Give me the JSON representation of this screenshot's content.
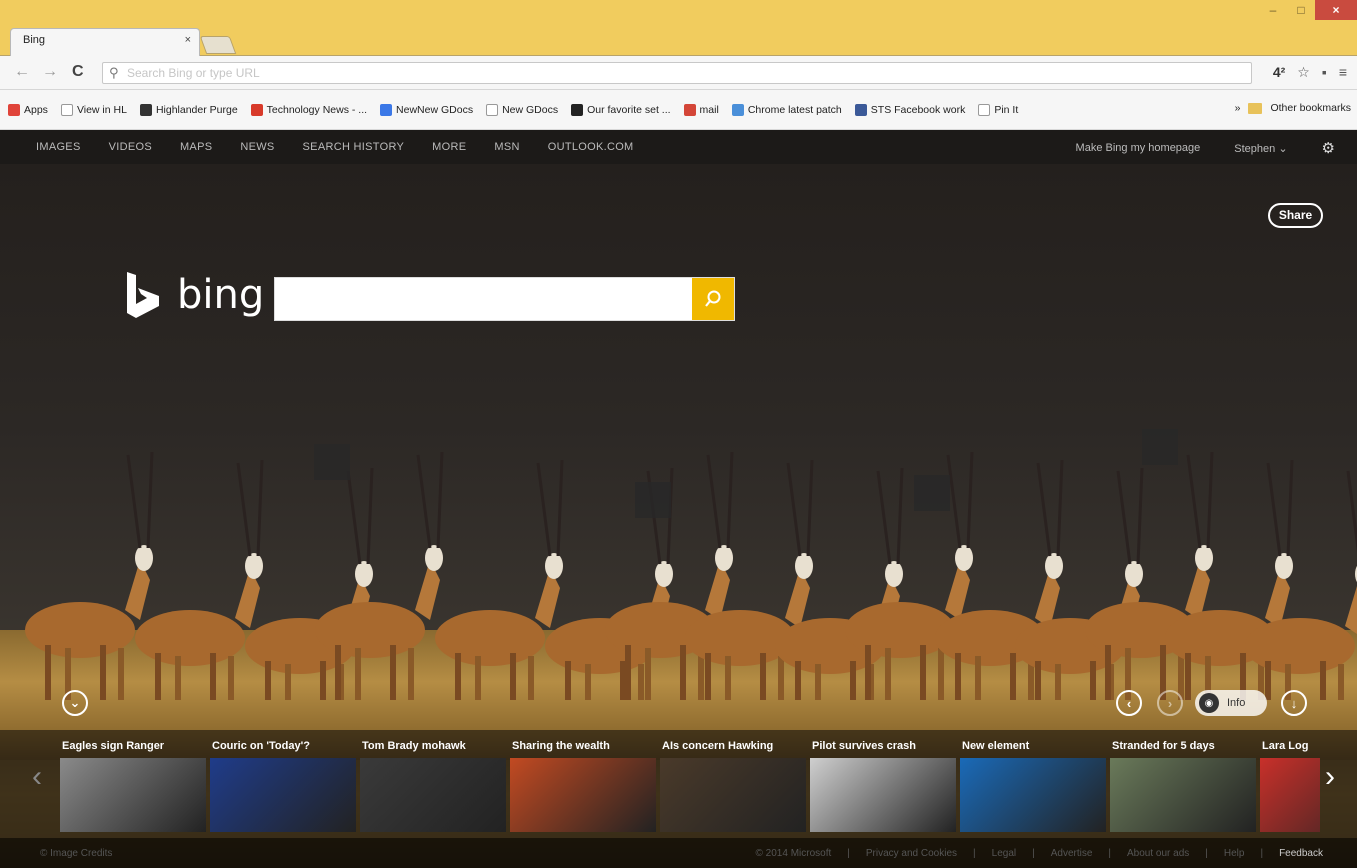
{
  "browser": {
    "tab_title": "Bing",
    "tab_close": "×",
    "omnibox_placeholder": "Search Bing or type URL",
    "window_controls": {
      "minimize": "–",
      "maximize": "□",
      "close": "×"
    }
  },
  "bookmarks": {
    "items": [
      {
        "label": "Apps",
        "icon": "apps-grid-icon",
        "color": "#e0443a"
      },
      {
        "label": "View in HL",
        "icon": "page-icon",
        "color": "#ffffff"
      },
      {
        "label": "Highlander Purge",
        "icon": "github-icon",
        "color": "#333333"
      },
      {
        "label": "Technology News - ...",
        "icon": "circle-logo-icon",
        "color": "#d83a2a"
      },
      {
        "label": "NewNew GDocs",
        "icon": "docs-icon",
        "color": "#3b78e7"
      },
      {
        "label": "New GDocs",
        "icon": "page-icon",
        "color": "#ffffff"
      },
      {
        "label": "Our favorite set ...",
        "icon": "star-plus-icon",
        "color": "#222222"
      },
      {
        "label": "mail",
        "icon": "gmail-icon",
        "color": "#d44638"
      },
      {
        "label": "Chrome latest patch",
        "icon": "chrome-icon",
        "color": "#4a8fd9"
      },
      {
        "label": "STS Facebook work",
        "icon": "facebook-icon",
        "color": "#3b5998"
      },
      {
        "label": "Pin It",
        "icon": "page-icon",
        "color": "#ffffff"
      }
    ],
    "overflow": "»",
    "other": "Other bookmarks"
  },
  "bing": {
    "nav": [
      "IMAGES",
      "VIDEOS",
      "MAPS",
      "NEWS",
      "SEARCH HISTORY",
      "MORE",
      "MSN",
      "OUTLOOK.COM"
    ],
    "make_homepage": "Make Bing my homepage",
    "user": "Stephen",
    "share": "Share",
    "logo_text": "bing",
    "info": "Info",
    "accent": "#f0b800"
  },
  "news": [
    {
      "title": "Eagles sign Ranger",
      "color": "#8a8a8a"
    },
    {
      "title": "Couric on 'Today'?",
      "color": "#1f3c8a"
    },
    {
      "title": "Tom Brady mohawk",
      "color": "#3a3a3a"
    },
    {
      "title": "Sharing the wealth",
      "color": "#c24a22"
    },
    {
      "title": "AIs concern Hawking",
      "color": "#4a3a2a"
    },
    {
      "title": "Pilot survives crash",
      "color": "#cfcfcf"
    },
    {
      "title": "New element",
      "color": "#1a6ab8"
    },
    {
      "title": "Stranded for 5 days",
      "color": "#6a7a5a"
    },
    {
      "title": "Lara Log",
      "color": "#c8302a"
    }
  ],
  "footer": {
    "left": "© Image Credits",
    "links": [
      "© 2014 Microsoft",
      "|",
      "Privacy and Cookies",
      "|",
      "Legal",
      "|",
      "Advertise",
      "|",
      "About our ads",
      "|",
      "Help",
      "|"
    ],
    "feedback": "Feedback"
  }
}
